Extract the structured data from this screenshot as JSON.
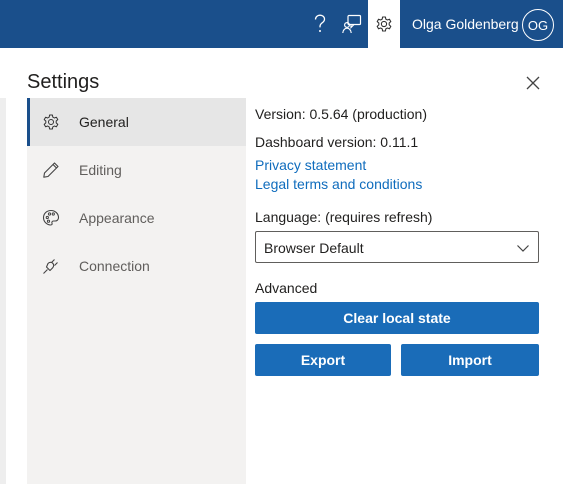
{
  "topbar": {
    "help_icon": "question-mark-icon",
    "feedback_icon": "feedback-icon",
    "settings_icon": "gear-icon",
    "user_name": "Olga Goldenberg",
    "avatar_initials": "OG",
    "bar_color": "#1a4f8b"
  },
  "settings": {
    "title": "Settings",
    "close_icon": "close-icon",
    "nav": [
      {
        "label": "General",
        "icon": "gear-icon",
        "selected": true
      },
      {
        "label": "Editing",
        "icon": "pencil-icon",
        "selected": false
      },
      {
        "label": "Appearance",
        "icon": "palette-icon",
        "selected": false
      },
      {
        "label": "Connection",
        "icon": "plug-icon",
        "selected": false
      }
    ],
    "general": {
      "version": "Version: 0.5.64 (production)",
      "dashboard_version": "Dashboard version: 0.11.1",
      "privacy_link": "Privacy statement",
      "legal_link": "Legal terms and conditions",
      "language_label": "Language: (requires refresh)",
      "language_value": "Browser Default",
      "advanced_label": "Advanced",
      "clear_button": "Clear local state",
      "export_button": "Export",
      "import_button": "Import"
    },
    "accent_color": "#1a6cb8",
    "link_color": "#0f6cbd"
  }
}
